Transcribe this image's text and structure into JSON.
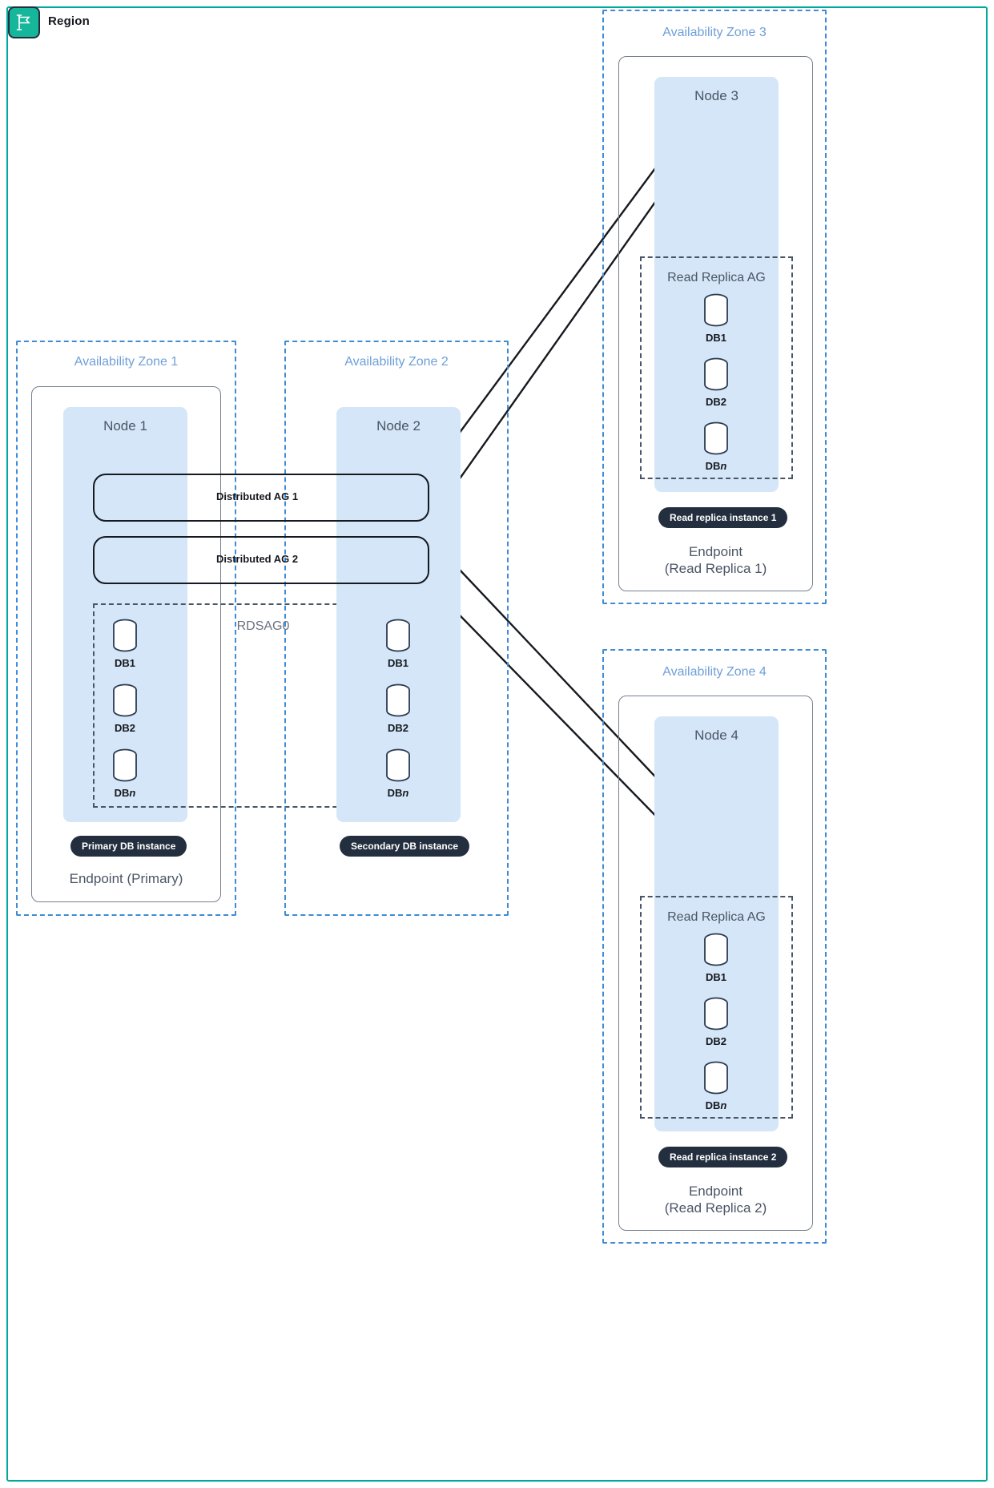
{
  "region": {
    "label": "Region",
    "icon": "flag-icon",
    "border_color": "#00a99d",
    "badge_color": "#16b69a"
  },
  "colors": {
    "az_border": "#3f8cd4",
    "az_title": "#6f9fd8",
    "node_fill": "#d4e6f7",
    "node_title": "#4b5565",
    "pill_bg": "#232f3e",
    "pill_text": "#ffffff",
    "ag_dash": "#4a5568",
    "line": "#16191f"
  },
  "availability_zones": [
    {
      "id": "az1",
      "title": "Availability Zone 1",
      "node": {
        "title": "Node 1"
      },
      "ag": {
        "title": "RDSAG0",
        "title_style": "grey"
      },
      "databases": [
        {
          "label": "DB1"
        },
        {
          "label": "DB2"
        },
        {
          "label": "DBn",
          "italic_suffix": true
        }
      ],
      "pill": "Primary DB instance",
      "endpoint": [
        "Endpoint (Primary)"
      ]
    },
    {
      "id": "az2",
      "title": "Availability Zone 2",
      "node": {
        "title": "Node 2"
      },
      "ag": {
        "title": "",
        "title_style": "grey"
      },
      "databases": [
        {
          "label": "DB1"
        },
        {
          "label": "DB2"
        },
        {
          "label": "DBn",
          "italic_suffix": true
        }
      ],
      "pill": "Secondary DB instance",
      "endpoint": [
        ""
      ]
    },
    {
      "id": "az3",
      "title": "Availability Zone 3",
      "node": {
        "title": "Node 3"
      },
      "ag": {
        "title": "Read Replica AG",
        "title_style": "dark"
      },
      "databases": [
        {
          "label": "DB1"
        },
        {
          "label": "DB2"
        },
        {
          "label": "DBn",
          "italic_suffix": true
        }
      ],
      "pill": "Read replica instance 1",
      "endpoint": [
        "Endpoint",
        "(Read Replica 1)"
      ]
    },
    {
      "id": "az4",
      "title": "Availability Zone 4",
      "node": {
        "title": "Node 4"
      },
      "ag": {
        "title": "Read Replica AG",
        "title_style": "dark"
      },
      "databases": [
        {
          "label": "DB1"
        },
        {
          "label": "DB2"
        },
        {
          "label": "DBn",
          "italic_suffix": true
        }
      ],
      "pill": "Read replica instance 2",
      "endpoint": [
        "Endpoint",
        "(Read Replica 2)"
      ]
    }
  ],
  "distributed_ags": [
    {
      "id": "dag1",
      "label": "Distributed AG 1"
    },
    {
      "id": "dag2",
      "label": "Distributed AG 2"
    }
  ]
}
